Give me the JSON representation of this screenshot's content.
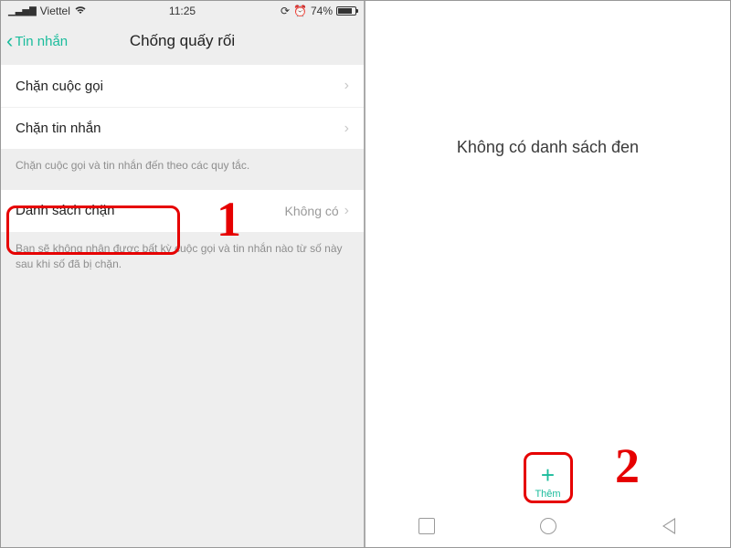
{
  "statusbar": {
    "carrier": "Viettel",
    "time": "11:25",
    "battery": "74%"
  },
  "navbar": {
    "back_label": "Tin nhắn",
    "title": "Chống quấy rối"
  },
  "rows": {
    "block_calls": "Chặn cuộc gọi",
    "block_sms": "Chặn tin nhắn",
    "blocklist_label": "Danh sách chặn",
    "blocklist_value": "Không có"
  },
  "help": {
    "text1": "Chặn cuộc gọi và tin nhắn đến theo các quy tắc.",
    "text2": "Bạn sẽ không nhận được bất kỳ cuộc gọi và tin nhắn nào từ số này sau khi số đã bị chặn."
  },
  "right_pane": {
    "empty": "Không có danh sách đen",
    "add_label": "Thêm"
  },
  "annotations": {
    "n1": "1",
    "n2": "2"
  }
}
